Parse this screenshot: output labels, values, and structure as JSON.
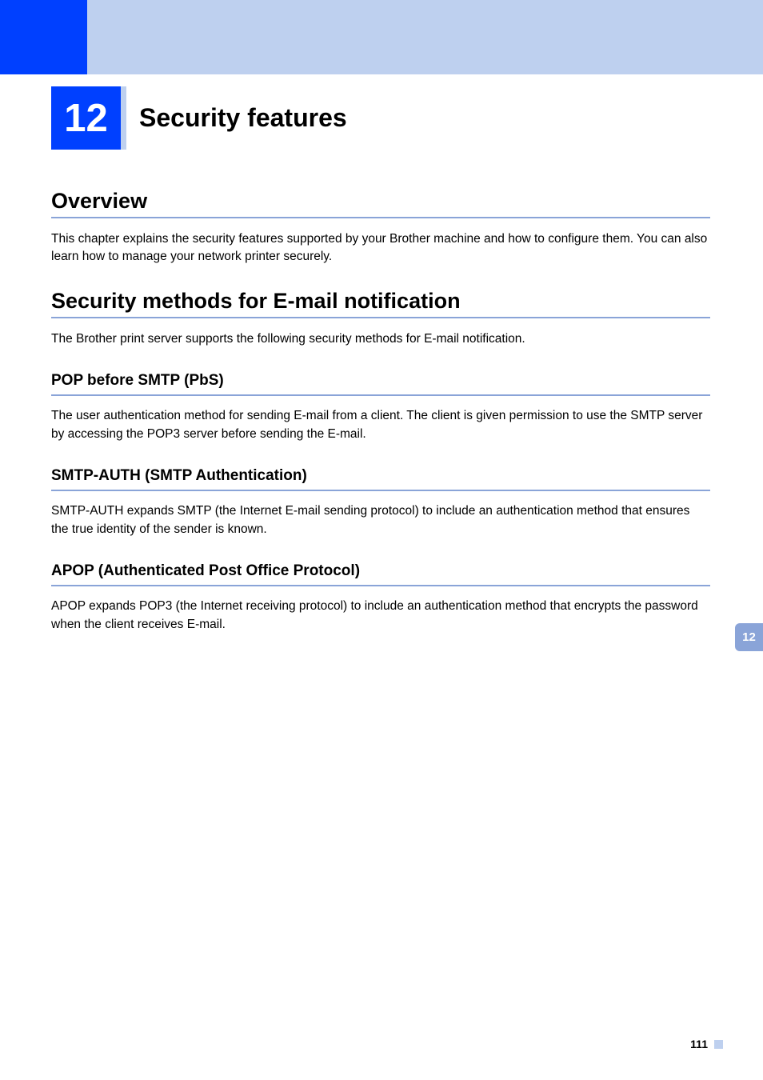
{
  "chapter": {
    "number": "12",
    "title": "Security features"
  },
  "sections": {
    "overview": {
      "heading": "Overview",
      "body": "This chapter explains the security features supported by your Brother machine and how to configure them. You can also learn how to manage your network printer securely."
    },
    "security_methods": {
      "heading": "Security methods for E-mail notification",
      "body": "The Brother print server supports the following security methods for E-mail notification.",
      "subsections": {
        "pbs": {
          "heading": "POP before SMTP (PbS)",
          "body": "The user authentication method for sending E-mail from a client. The client is given permission to use the SMTP server by accessing the POP3 server before sending the E-mail."
        },
        "smtp_auth": {
          "heading": "SMTP-AUTH (SMTP Authentication)",
          "body": "SMTP-AUTH expands SMTP (the Internet E-mail sending protocol) to include an authentication method that ensures the true identity of the sender is known."
        },
        "apop": {
          "heading": "APOP (Authenticated Post Office Protocol)",
          "body": "APOP expands POP3 (the Internet receiving protocol) to include an authentication method that encrypts the password when the client receives E-mail."
        }
      }
    }
  },
  "side_tab": "12",
  "page_number": "111"
}
